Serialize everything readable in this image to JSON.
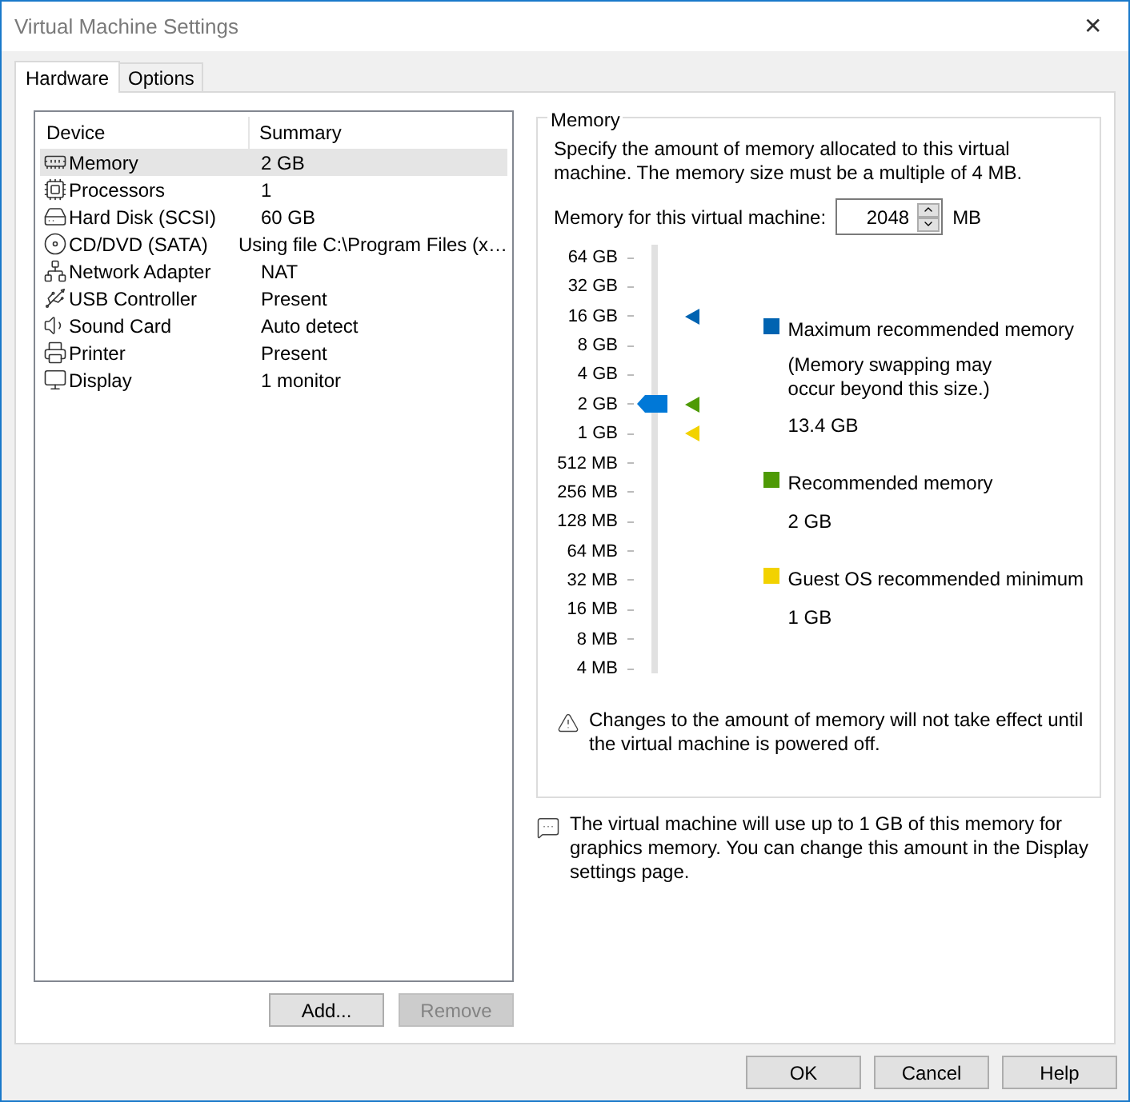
{
  "window": {
    "title": "Virtual Machine Settings",
    "close": "✕"
  },
  "tabs": [
    {
      "label": "Hardware",
      "selected": true
    },
    {
      "label": "Options",
      "selected": false
    }
  ],
  "devices": {
    "columns": [
      "Device",
      "Summary"
    ],
    "rows": [
      {
        "kind": "memory",
        "device": "Memory",
        "summary": "2 GB",
        "selected": true
      },
      {
        "kind": "cpu",
        "device": "Processors",
        "summary": "1",
        "selected": false
      },
      {
        "kind": "disk",
        "device": "Hard Disk (SCSI)",
        "summary": "60 GB",
        "selected": false
      },
      {
        "kind": "cd",
        "device": "CD/DVD (SATA)",
        "summary": "Using file C:\\Program Files (x…",
        "selected": false
      },
      {
        "kind": "network",
        "device": "Network Adapter",
        "summary": "NAT",
        "selected": false
      },
      {
        "kind": "usb",
        "device": "USB Controller",
        "summary": "Present",
        "selected": false
      },
      {
        "kind": "sound",
        "device": "Sound Card",
        "summary": "Auto detect",
        "selected": false
      },
      {
        "kind": "printer",
        "device": "Printer",
        "summary": "Present",
        "selected": false
      },
      {
        "kind": "display",
        "device": "Display",
        "summary": "1 monitor",
        "selected": false
      }
    ],
    "buttons": [
      {
        "label": "Add...",
        "disabled": false
      },
      {
        "label": "Remove",
        "disabled": true
      }
    ]
  },
  "memory": {
    "title": "Memory",
    "description": "Specify the amount of memory allocated to this virtual machine. The memory size must be a multiple of 4 MB.",
    "field_label": "Memory for this virtual machine:",
    "value": "2048",
    "unit": "MB",
    "slider": {
      "level": 0.643,
      "ticks": [
        {
          "label": "64 GB"
        },
        {
          "label": "32 GB"
        },
        {
          "label": "16 GB",
          "color": "#0063b1"
        },
        {
          "label": "8 GB"
        },
        {
          "label": "4 GB"
        },
        {
          "label": "2 GB",
          "color": "#4e9a06"
        },
        {
          "label": "1 GB",
          "color": "#f2d200"
        },
        {
          "label": "512 MB"
        },
        {
          "label": "256 MB"
        },
        {
          "label": "128 MB"
        },
        {
          "label": "64 MB"
        },
        {
          "label": "32 MB"
        },
        {
          "label": "16 MB"
        },
        {
          "label": "8 MB"
        },
        {
          "label": "4 MB"
        }
      ]
    },
    "legend": [
      {
        "color": "#0063b1",
        "title": "Maximum recommended memory",
        "note": "(Memory swapping may occur beyond this size.)",
        "value": "13.4 GB"
      },
      {
        "color": "#4e9a06",
        "title": "Recommended memory",
        "value": "2 GB"
      },
      {
        "color": "#f2d200",
        "title": "Guest OS recommended minimum",
        "value": "1 GB"
      }
    ],
    "warning": "Changes to the amount of memory will not take effect until the virtual machine is powered off."
  },
  "info": "The virtual machine will use up to 1 GB of this memory for graphics memory. You can change this amount in the Display settings page.",
  "footer_buttons": [
    "OK",
    "Cancel",
    "Help"
  ]
}
